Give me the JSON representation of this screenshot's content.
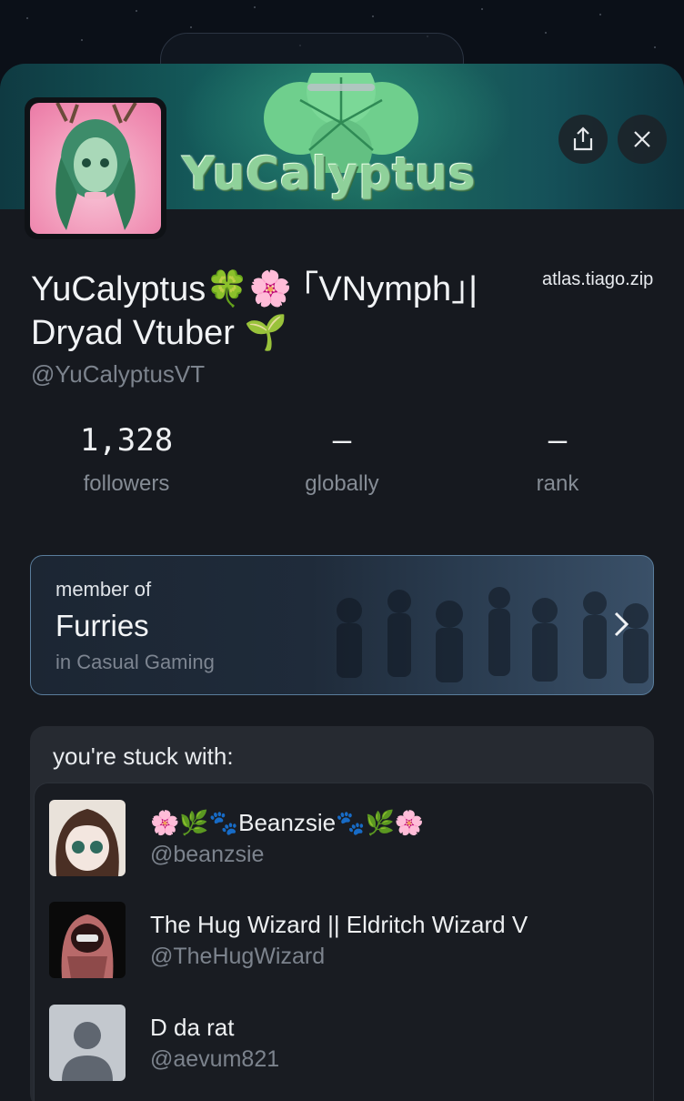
{
  "profile": {
    "banner_title": "YuCalyptus",
    "display_name_line1": "YuCalyptus🍀🌸 ｢VNymph｣|",
    "display_name_line2": "Dryad Vtuber 🌱",
    "handle": "@YuCalyptusVT",
    "watermark": "atlas.tiago.zip"
  },
  "stats": [
    {
      "value": "1,328",
      "label": "followers"
    },
    {
      "value": "–",
      "label": "globally"
    },
    {
      "value": "–",
      "label": "rank"
    }
  ],
  "member_card": {
    "small_label": "member of",
    "community": "Furries",
    "category": "in Casual Gaming"
  },
  "stuck_with": {
    "title": "you're stuck with:",
    "users": [
      {
        "name": "🌸🌿🐾Beanzsie🐾🌿🌸",
        "handle": "@beanzsie"
      },
      {
        "name": "The Hug Wizard || Eldritch Wizard V",
        "handle": "@TheHugWizard"
      },
      {
        "name": "D da rat",
        "handle": "@aevum821"
      }
    ]
  },
  "icons": {
    "share": "share-icon",
    "close": "close-icon",
    "chevron": "chevron-right-icon"
  },
  "colors": {
    "background": "#16191f",
    "card_border": "#5a7d9c",
    "banner_green": "#8fd19a"
  }
}
